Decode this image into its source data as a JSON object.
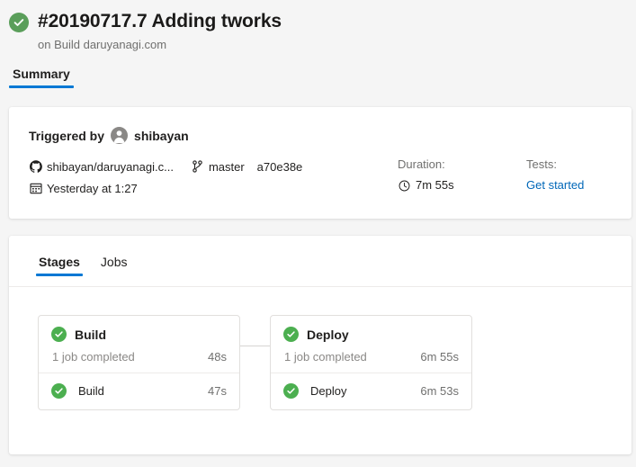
{
  "header": {
    "status_icon": "check-circle-icon",
    "status_color": "#5a9e5a",
    "title": "#20190717.7 Adding tworks",
    "subtitle": "on Build daruyanagi.com",
    "tabs": [
      {
        "label": "Summary",
        "active": true
      }
    ]
  },
  "summary": {
    "triggered_label": "Triggered by",
    "avatar_icon": "user-avatar-icon",
    "triggered_user": "shibayan",
    "repo_icon": "github-icon",
    "repo": "shibayan/daruyanagi.c...",
    "branch_icon": "branch-icon",
    "branch": "master",
    "commit": "a70e38e",
    "date_icon": "calendar-icon",
    "date": "Yesterday at 1:27",
    "duration_label": "Duration:",
    "duration_icon": "clock-icon",
    "duration_value": "7m 55s",
    "tests_label": "Tests:",
    "tests_link": "Get started",
    "link_color": "#0067b8"
  },
  "stages_panel": {
    "tabs": [
      {
        "label": "Stages",
        "active": true
      },
      {
        "label": "Jobs",
        "active": false
      }
    ],
    "stages": [
      {
        "name": "Build",
        "status_icon": "check-circle-icon",
        "summary": "1 job completed",
        "duration": "48s",
        "jobs": [
          {
            "name": "Build",
            "status_icon": "check-circle-icon",
            "duration": "47s"
          }
        ]
      },
      {
        "name": "Deploy",
        "status_icon": "check-circle-icon",
        "summary": "1 job completed",
        "duration": "6m 55s",
        "jobs": [
          {
            "name": "Deploy",
            "status_icon": "check-circle-icon",
            "duration": "6m 53s"
          }
        ]
      }
    ],
    "success_color": "#4caf50"
  }
}
